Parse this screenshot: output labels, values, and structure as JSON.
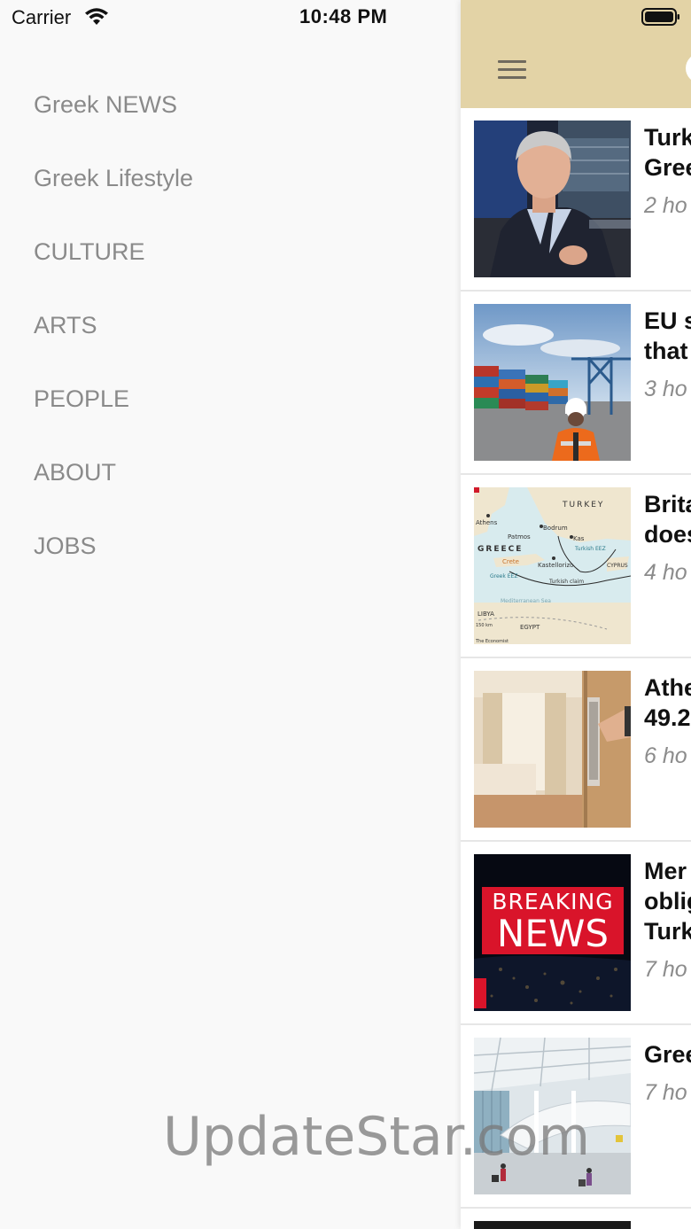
{
  "status_bar": {
    "carrier": "Carrier",
    "time": "10:48 PM",
    "icons": [
      "wifi-icon",
      "battery-icon"
    ]
  },
  "side_menu": {
    "items": [
      {
        "label": "Greek NEWS"
      },
      {
        "label": "Greek Lifestyle"
      },
      {
        "label": "CULTURE"
      },
      {
        "label": "ARTS"
      },
      {
        "label": "PEOPLE"
      },
      {
        "label": "ABOUT"
      },
      {
        "label": "JOBS"
      }
    ]
  },
  "nav_bar": {
    "background_color": "#e3d3a6",
    "menu_icon": "hamburger-icon"
  },
  "articles": [
    {
      "title": "Turk\nGree",
      "time": "2 ho",
      "image": "man-in-suit-photo"
    },
    {
      "title": "EU s\nthat",
      "time": "3 ho",
      "image": "container-port-photo"
    },
    {
      "title": "Brita\ndoes",
      "time": "4 ho",
      "image": "aegean-map-image"
    },
    {
      "title": "Athe\n49.2",
      "time": "6 ho",
      "image": "hotel-room-photo"
    },
    {
      "title": "Mer\noblig\nTurk",
      "time": "7 ho",
      "image": "breaking-news-image"
    },
    {
      "title": "Gree",
      "time": "7 ho",
      "image": "airport-terminal-photo"
    }
  ],
  "map_labels": {
    "turkey": "TURKEY",
    "greece": "GREECE",
    "athens": "Athens",
    "bodrum": "Bodrum",
    "patmos": "Patmos",
    "kas": "Kas",
    "kastellorizo": "Kastellorizo",
    "crete": "Crete",
    "greek_eez": "Greek EEZ",
    "turkish_eez": "Turkish EEZ",
    "turkish_claim": "Turkish claim",
    "cyprus": "CYPRUS",
    "libya": "LIBYA",
    "egypt": "EGYPT",
    "sea": "Mediterranean Sea",
    "scale": "150 km",
    "source": "The Economist"
  },
  "breaking_news": {
    "line1": "BREAKING",
    "line2": "NEWS"
  },
  "watermark": "UpdateStar.com"
}
